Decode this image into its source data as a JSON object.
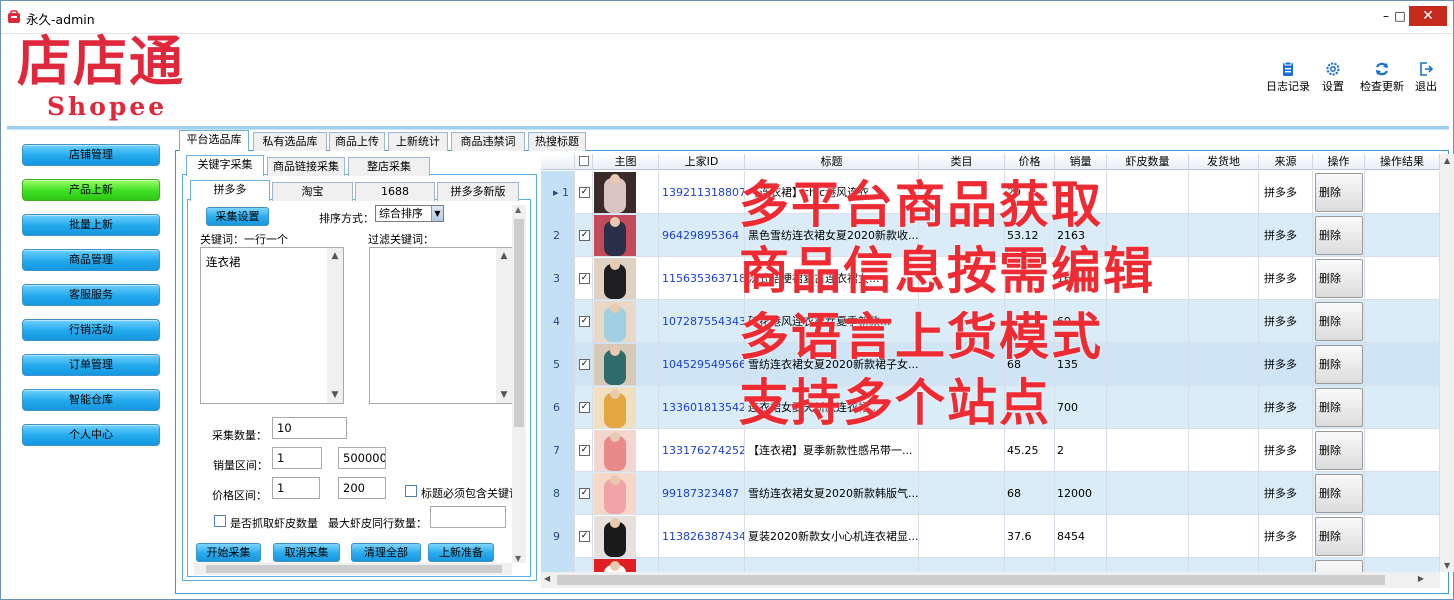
{
  "window": {
    "title": "永久-admin"
  },
  "logo": {
    "cn": "店店通",
    "en": "Shopee"
  },
  "toolbar": [
    {
      "label": "日志记录",
      "icon": "clipboard-icon"
    },
    {
      "label": "设置",
      "icon": "gear-icon"
    },
    {
      "label": "检查更新",
      "icon": "refresh-icon"
    },
    {
      "label": "退出",
      "icon": "exit-icon"
    }
  ],
  "sidebar": {
    "items": [
      {
        "label": "店铺管理"
      },
      {
        "label": "产品上新",
        "active": true
      },
      {
        "label": "批量上新"
      },
      {
        "label": "商品管理"
      },
      {
        "label": "客服服务"
      },
      {
        "label": "行销活动"
      },
      {
        "label": "订单管理"
      },
      {
        "label": "智能仓库"
      },
      {
        "label": "个人中心"
      }
    ]
  },
  "main_tabs": [
    "平台选品库",
    "私有选品库",
    "商品上传",
    "上新统计",
    "商品违禁词",
    "热搜标题"
  ],
  "sub_tabs": [
    "关键字采集",
    "商品链接采集",
    "整店采集"
  ],
  "platform_tabs": [
    "拼多多",
    "淘宝",
    "1688",
    "拼多多新版"
  ],
  "form": {
    "collect_settings": "采集设置",
    "sort_label": "排序方式：",
    "sort_value": "综合排序",
    "keywords_label": "关键词：一行一个",
    "filter_label": "过滤关键词：",
    "keywords_value": "连衣裙",
    "count_label": "采集数量：",
    "count_value": "10",
    "sales_label": "销量区间：",
    "sales_min": "1",
    "sales_max": "500000",
    "price_label": "价格区间：",
    "price_min": "1",
    "price_max": "200",
    "title_must_contain": "标题必须包含关键词",
    "grab_shrimp": "是否抓取虾皮数量",
    "max_shrimp_label": "最大虾皮同行数量：",
    "buttons": [
      "开始采集",
      "取消采集",
      "清理全部",
      "上新准备"
    ]
  },
  "table": {
    "columns": [
      "",
      "主图",
      "上家ID",
      "标题",
      "类目",
      "价格",
      "销量",
      "虾皮数量",
      "发货地",
      "来源",
      "操作",
      "操作结果"
    ],
    "rows": [
      {
        "n": "1",
        "id": "139211318807",
        "title": "【连衣裙】chic港风连衣...",
        "price": "29",
        "sales": "1",
        "source": "拼多多",
        "op": "删除",
        "img": "#d8c4c0",
        "img2": "#3a2a2a"
      },
      {
        "n": "2",
        "id": "96429895364",
        "title": "黑色雪纺连衣裙女夏2020新款收...",
        "price": "53.12",
        "sales": "2163",
        "source": "拼多多",
        "op": "删除",
        "img": "#2a2f4a",
        "img2": "#c34a5a"
      },
      {
        "n": "3",
        "id": "115635363718",
        "title": "法式桔梗裙复古连衣裙女...",
        "price": "",
        "sales": "16",
        "source": "拼多多",
        "op": "删除",
        "img": "#1e1e22",
        "img2": "#e0d2c2"
      },
      {
        "n": "4",
        "id": "107287554343",
        "title": "碎花港风连衣裙女夏季新款...",
        "price": "",
        "sales": "69",
        "source": "拼多多",
        "op": "删除",
        "img": "#9fcfe0",
        "img2": "#e8d8c8"
      },
      {
        "n": "5",
        "id": "104529549566",
        "title": "雪纺连衣裙女夏2020新款裙子女...",
        "price": "68",
        "sales": "135",
        "source": "拼多多",
        "op": "删除",
        "img": "#2f6b6a",
        "img2": "#d6c9b8"
      },
      {
        "n": "6",
        "id": "133601813542",
        "title": "连衣裙女夏天新款连衣裙...",
        "price": "",
        "sales": "700",
        "source": "拼多多",
        "op": "删除",
        "img": "#e3a640",
        "img2": "#f0e0c0"
      },
      {
        "n": "7",
        "id": "133176274252",
        "title": "【连衣裙】夏季新款性感吊带一...",
        "price": "45.25",
        "sales": "2",
        "source": "拼多多",
        "op": "删除",
        "img": "#e88a8a",
        "img2": "#f3d6d0"
      },
      {
        "n": "8",
        "id": "99187323487",
        "title": "雪纺连衣裙女夏2020新款韩版气...",
        "price": "68",
        "sales": "12000",
        "source": "拼多多",
        "op": "删除",
        "img": "#f0a4a8",
        "img2": "#f6d8c8"
      },
      {
        "n": "9",
        "id": "113826387434",
        "title": "夏装2020新款女小心机连衣裙显...",
        "price": "37.6",
        "sales": "8454",
        "source": "拼多多",
        "op": "删除",
        "img": "#1a1a1a",
        "img2": "#e8e0da"
      },
      {
        "n": "",
        "id": "",
        "title": "",
        "price": "",
        "sales": "",
        "source": "",
        "op": "删除",
        "img": "#ffffff",
        "img2": "#e02020"
      }
    ]
  },
  "overlay": [
    "多平台商品获取",
    "商品信息按需编辑",
    "多语言上货模式",
    "支持多个站点"
  ],
  "colors": {
    "accent": "#1fa5ea",
    "active": "#3ee020",
    "brand": "#e0283c",
    "overlay": "#ee2a33"
  }
}
